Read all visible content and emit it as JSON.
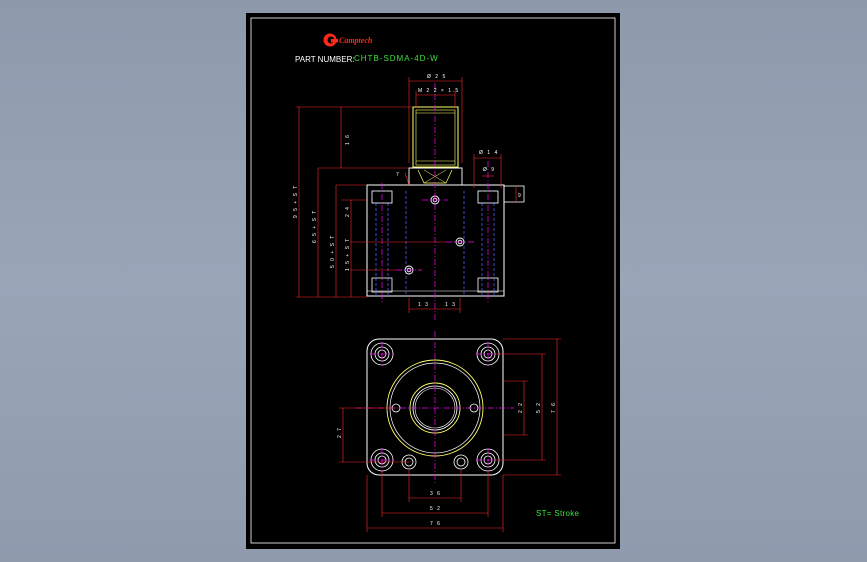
{
  "title_block": {
    "brand": "Camptech",
    "part_number_label": "PART NUMBER:",
    "part_number": "CHTB-SDMA-4D-W"
  },
  "dimensions": {
    "dia_top": "Ø 2 5",
    "thread": "M 2 2 × 1.5",
    "height_16": "1 6",
    "dia_14": "Ø 1 4",
    "dia_9": "Ø 9",
    "seven": "7",
    "nine": "9",
    "total_height": "9 5 + S T",
    "height_65": "6 5 + S T",
    "height_50": "5 0 + S T",
    "height_24": "2 4",
    "height_15": "1 5 + S T",
    "bottom_13a": "1 3",
    "bottom_13b": "1 3",
    "right_22": "2 2",
    "right_52": "5 2",
    "right_76": "7 6",
    "left_27": "2 7",
    "bottom_36": "3 6",
    "bottom_52": "5 2",
    "bottom_76": "7 6"
  },
  "legend": {
    "stroke_note": "ST= Stroke"
  },
  "colors": {
    "sheet": "#000000",
    "frame": "#ffffff",
    "outline": "#ffffff",
    "dimension": "#ff2a2a",
    "centerline": "#ff00ff",
    "hidden": "#4a5cff",
    "highlight": "#ffff66",
    "note": "#39e23a"
  }
}
